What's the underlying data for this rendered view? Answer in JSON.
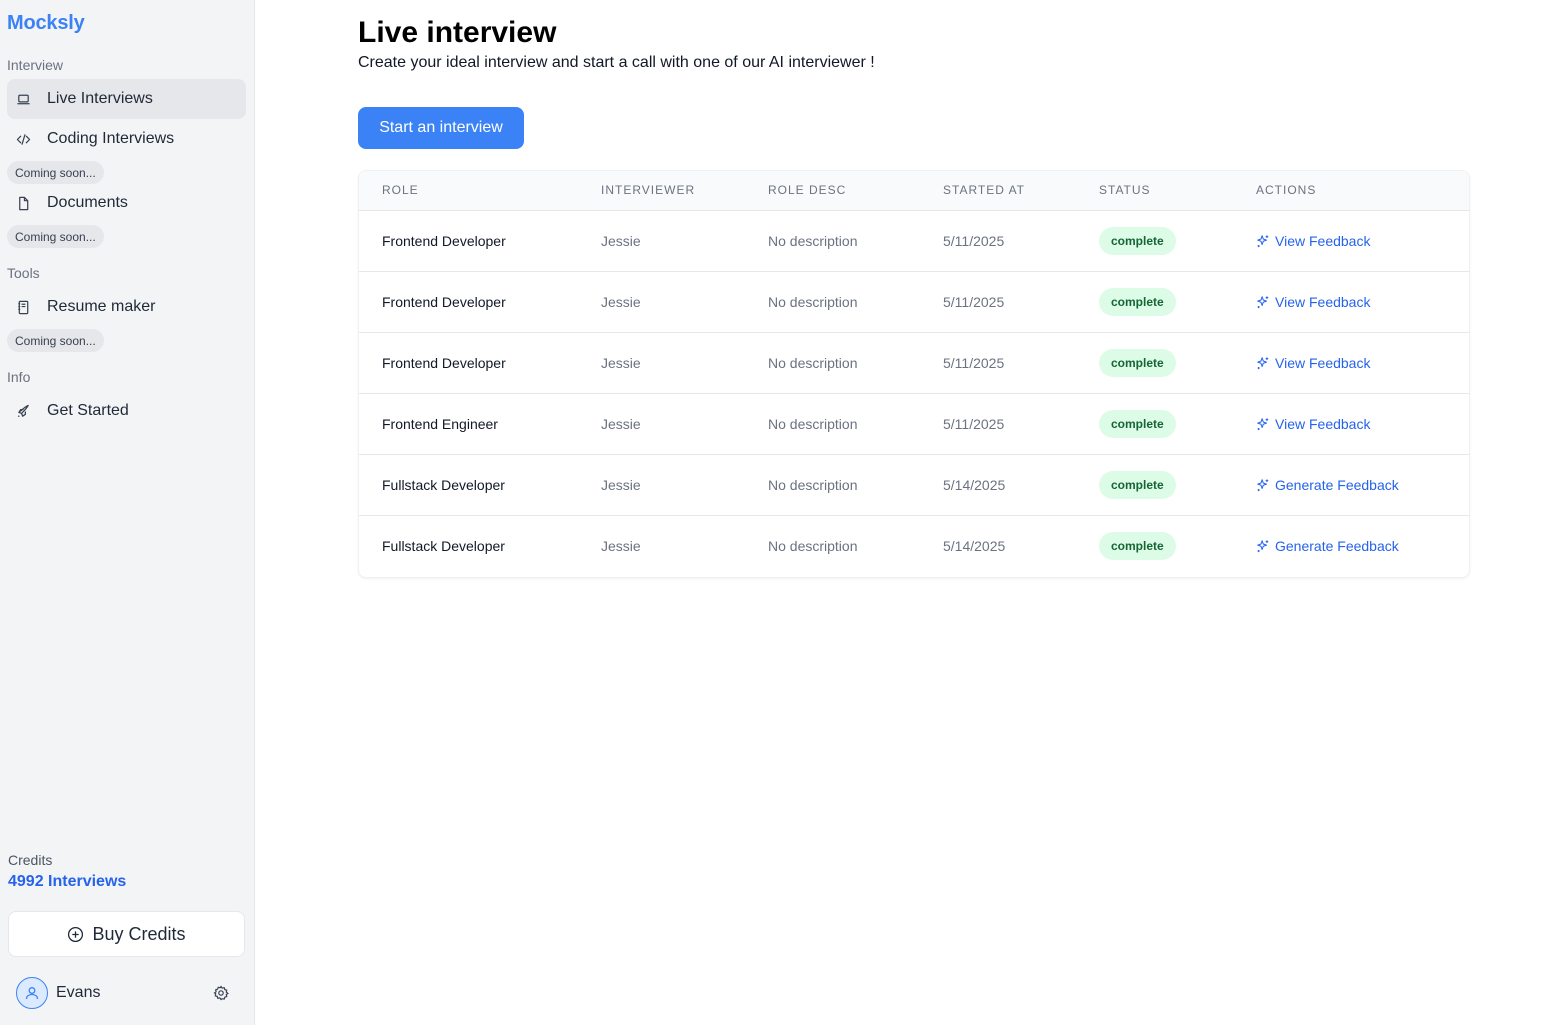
{
  "app": {
    "brand": "Mocksly"
  },
  "sidebar": {
    "sections": {
      "interview": "Interview",
      "tools": "Tools",
      "info": "Info"
    },
    "items": [
      {
        "label": "Live Interviews",
        "icon": "laptop-icon"
      },
      {
        "label": "Coding Interviews",
        "icon": "code-icon"
      },
      {
        "label": "Documents",
        "icon": "file-icon"
      },
      {
        "label": "Resume maker",
        "icon": "notebook-icon"
      },
      {
        "label": "Get Started",
        "icon": "rocket-icon"
      }
    ],
    "coming_soon": "Coming soon...",
    "credits_label": "Credits",
    "credits_value": "4992 Interviews",
    "buy_label": "Buy Credits",
    "user_name": "Evans"
  },
  "main": {
    "title": "Live interview",
    "subtitle": "Create your ideal interview and start a call with one of our AI interviewer !",
    "start_button": "Start an interview",
    "table": {
      "headers": [
        "ROLE",
        "INTERVIEWER",
        "ROLE DESC",
        "STARTED AT",
        "STATUS",
        "ACTIONS"
      ],
      "rows": [
        {
          "role": "Frontend Developer",
          "interviewer": "Jessie",
          "desc": "No description",
          "started": "5/11/2025",
          "status": "complete",
          "action": "View Feedback"
        },
        {
          "role": "Frontend Developer",
          "interviewer": "Jessie",
          "desc": "No description",
          "started": "5/11/2025",
          "status": "complete",
          "action": "View Feedback"
        },
        {
          "role": "Frontend Developer",
          "interviewer": "Jessie",
          "desc": "No description",
          "started": "5/11/2025",
          "status": "complete",
          "action": "View Feedback"
        },
        {
          "role": "Frontend Engineer",
          "interviewer": "Jessie",
          "desc": "No description",
          "started": "5/11/2025",
          "status": "complete",
          "action": "View Feedback"
        },
        {
          "role": "Fullstack Developer",
          "interviewer": "Jessie",
          "desc": "No description",
          "started": "5/14/2025",
          "status": "complete",
          "action": "Generate Feedback"
        },
        {
          "role": "Fullstack Developer",
          "interviewer": "Jessie",
          "desc": "No description",
          "started": "5/14/2025",
          "status": "complete",
          "action": "Generate Feedback"
        }
      ]
    }
  },
  "colors": {
    "accent": "#3b82f6",
    "link": "#2563eb",
    "badge_bg": "#dcfce7",
    "badge_text": "#166534",
    "sidebar_bg": "#f3f4f6"
  }
}
